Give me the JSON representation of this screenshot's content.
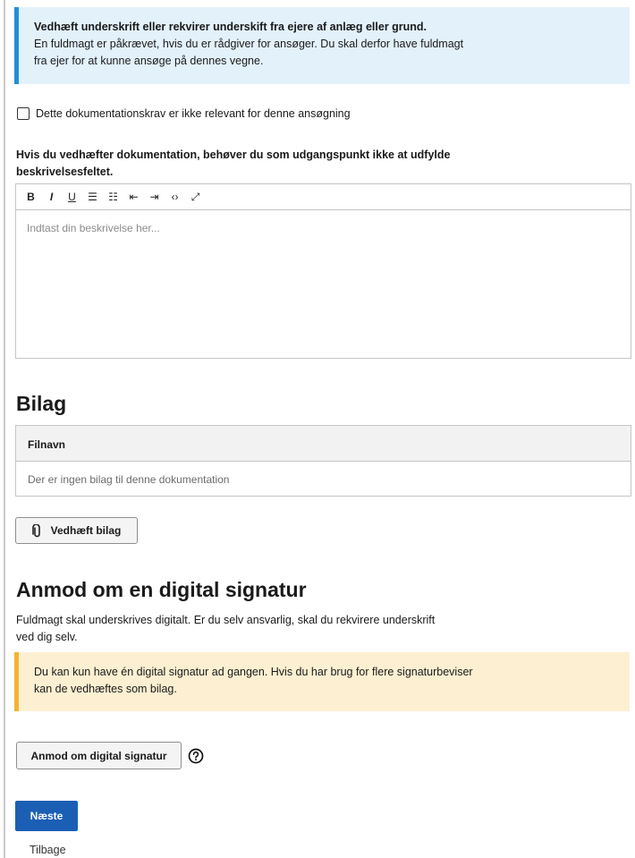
{
  "info": {
    "title": "Vedhæft underskrift eller rekvirer underskift fra ejere af anlæg eller grund.",
    "line1": "En fuldmagt er påkrævet, hvis du er rådgiver for ansøger. Du skal derfor have fuldmagt",
    "line2": "fra ejer for at kunne ansøge på dennes vegne."
  },
  "not_relevant_label": "Dette dokumentationskrav er ikke relevant for denne ansøgning",
  "description": {
    "label_line1": "Hvis du vedhæfter dokumentation, behøver du som udgangspunkt ikke at udfylde",
    "label_line2": "beskrivelsesfeltet.",
    "placeholder": "Indtast din beskrivelse her...",
    "toolbar": {
      "bold": "B",
      "italic": "I",
      "underline": "U",
      "bullet_list": "☰",
      "numbered_list": "☷",
      "outdent": "⇤",
      "indent": "⇥",
      "code": "‹›",
      "fullscreen": "⤢"
    }
  },
  "attachments": {
    "heading": "Bilag",
    "column_filename": "Filnavn",
    "empty_text": "Der er ingen bilag til denne dokumentation",
    "attach_button": "Vedhæft bilag"
  },
  "signature": {
    "heading": "Anmod om en digital signatur",
    "desc_line1": "Fuldmagt skal underskrives digitalt. Er du selv ansvarlig, skal du rekvirere underskrift",
    "desc_line2": "ved dig selv.",
    "warning_line1": "Du kan kun have én digital signatur ad gangen. Hvis du har brug for flere signaturbeviser",
    "warning_line2": "kan de vedhæftes som bilag.",
    "request_button": "Anmod om digital signatur"
  },
  "nav": {
    "next": "Næste",
    "back": "Tilbage"
  },
  "colors": {
    "info_accent": "#1f8fd6",
    "info_bg": "#e3f1fb",
    "warning_accent": "#f2b430",
    "warning_bg": "#fdf0d2",
    "primary_button": "#1a5fb4"
  }
}
